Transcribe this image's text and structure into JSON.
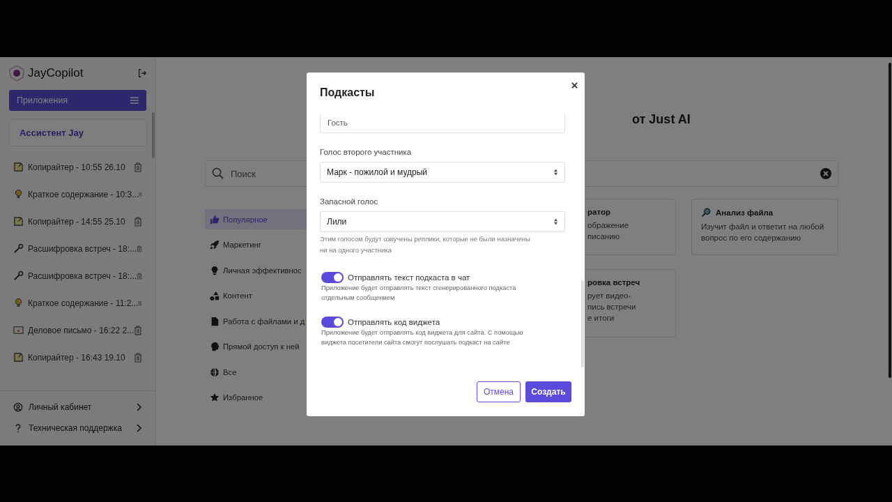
{
  "app": {
    "name": "JayCopilot"
  },
  "sidebar": {
    "apps_button": "Приложения",
    "assistant": "Ассистент Jay",
    "history": [
      {
        "kind": "note",
        "title": "Копирайтер - 10:55 26.10"
      },
      {
        "kind": "bulb",
        "title": "Краткое содержание - 10:3..."
      },
      {
        "kind": "note",
        "title": "Копирайтер - 14:55 25.10"
      },
      {
        "kind": "mic",
        "title": "Расшифровка встреч - 18:..."
      },
      {
        "kind": "mic",
        "title": "Расшифровка встреч - 18:..."
      },
      {
        "kind": "bulb",
        "title": "Краткое содержание - 11:2..."
      },
      {
        "kind": "letter",
        "title": "Деловое письмо - 16:22 2..."
      },
      {
        "kind": "note",
        "title": "Копирайтер - 16:43 19.10"
      }
    ],
    "footer": [
      {
        "kind": "account",
        "label": "Личный кабинет"
      },
      {
        "kind": "help",
        "label": "Техническая поддержка"
      }
    ]
  },
  "main": {
    "title": "от Just AI",
    "search": {
      "placeholder": "Поиск"
    },
    "categories": [
      {
        "kind": "thumb",
        "label": "Популярное",
        "selected": true
      },
      {
        "kind": "rocket",
        "label": "Маркетинг",
        "selected": false
      },
      {
        "kind": "bulb",
        "label": "Личная эффективнос",
        "selected": false
      },
      {
        "kind": "shapes",
        "label": "Контент",
        "selected": false
      },
      {
        "kind": "file",
        "label": "Работа с файлами и д",
        "selected": false
      },
      {
        "kind": "head",
        "label": "Прямой доступ к ней",
        "selected": false
      },
      {
        "kind": "globe",
        "label": "Все",
        "selected": false
      },
      {
        "kind": "star",
        "label": "Избранное",
        "selected": false
      }
    ],
    "cards": [
      {
        "title": "ратор",
        "icon": false,
        "lines": [
          "ображение",
          "писанию"
        ]
      },
      {
        "title": "Анализ файла",
        "icon": true,
        "lines": [
          "Изучит файл и ответит на любой",
          "вопрос по его содержанию"
        ]
      },
      {
        "title": "ровка встреч",
        "icon": false,
        "lines": [
          "рует видео-",
          "пись встречи",
          "е итоги"
        ]
      }
    ]
  },
  "modal": {
    "title": "Подкасты",
    "guest_value": "Гость",
    "fields": [
      {
        "label": "Голос второго участника",
        "value": "Марк - пожилой и мудрый"
      },
      {
        "label": "Запасной голос",
        "value": "Лили",
        "hint": "Этим голосом будут озвучены реплики, которые не были назначены ни на одного участника"
      }
    ],
    "toggles": [
      {
        "label": "Отправлять текст подкаста в чат",
        "on": true,
        "description": "Приложение будет отправлять текст сгенерированного подкаста отдельным сообщением"
      },
      {
        "label": "Отправлять код виджета",
        "on": true,
        "description": "Приложение будет отправлять код виджета для сайта. С помощью виджета посетители сайта смогут послушать подкаст на сайте"
      }
    ],
    "cancel": "Отмена",
    "create": "Создать"
  }
}
